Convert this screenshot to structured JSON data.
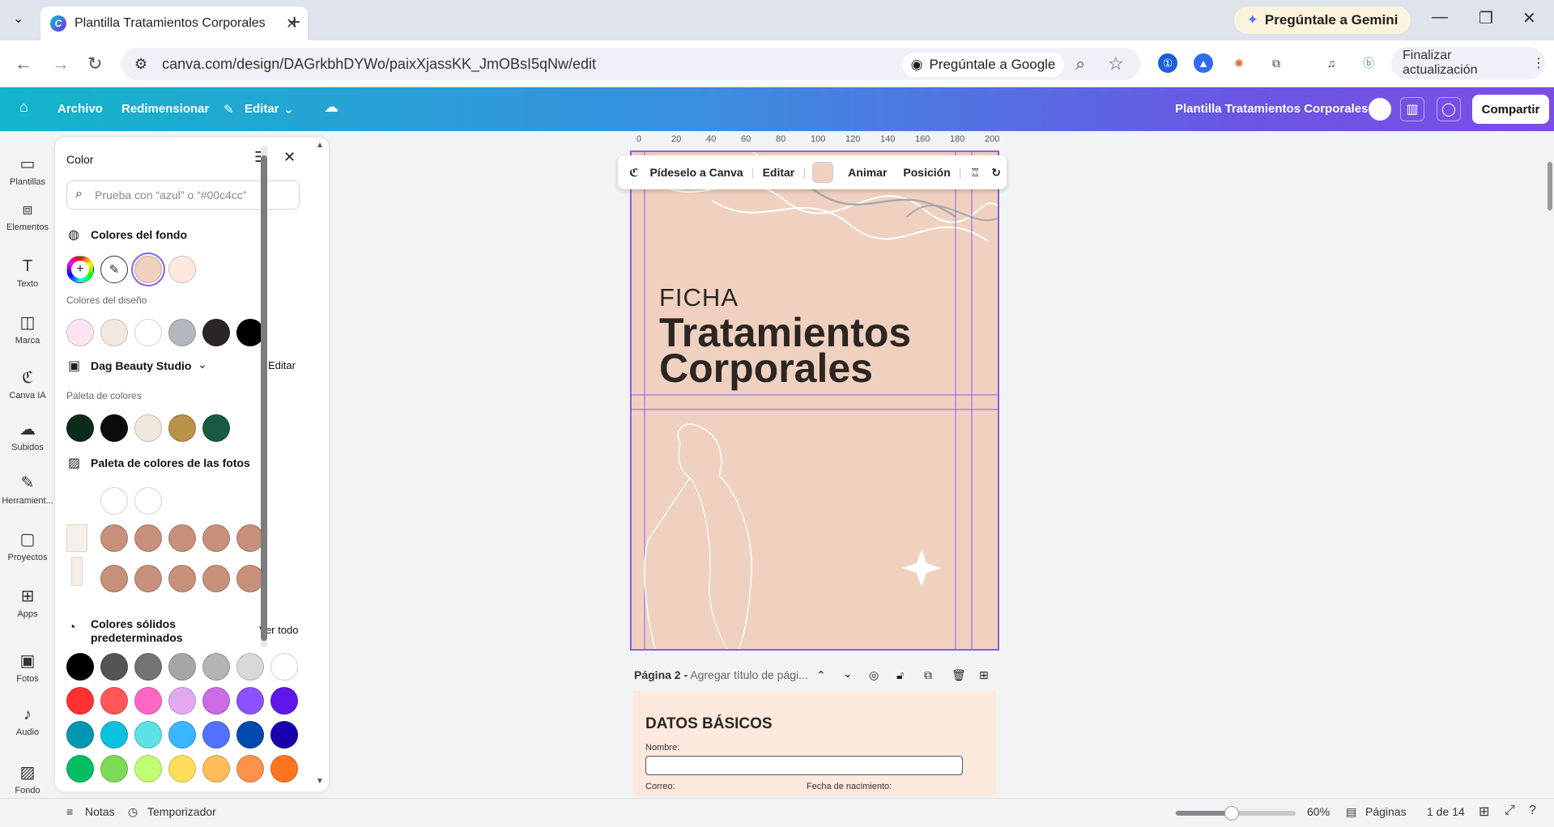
{
  "browser": {
    "tab_title": "Plantilla Tratamientos Corporales",
    "new_tab_symbol": "+",
    "gemini_label": "Pregúntale a Gemini",
    "url": "canva.com/design/DAGrkbhDYWo/paixXjassKK_JmOBsI5qNw/edit",
    "ask_google_label": "Pregúntale a Google",
    "update_label": "Finalizar actualización"
  },
  "header": {
    "archivo": "Archivo",
    "redimensionar": "Redimensionar",
    "editar": "Editar",
    "design_title": "Plantilla Tratamientos Corporales",
    "share_label": "Compartir"
  },
  "rail": {
    "items": [
      "Plantillas",
      "Elementos",
      "Texto",
      "Marca",
      "Canva IA",
      "Subidos",
      "Herramient...",
      "Proyectos",
      "Apps",
      "Fotos",
      "Audio",
      "Fondo"
    ]
  },
  "color_panel": {
    "title": "Color",
    "search_placeholder": "Prueba con “azul” o “#00c4cc”",
    "background_colors_title": "Colores del fondo",
    "background_swatches": [
      "#f0d1bf",
      "#fde9dd"
    ],
    "design_colors_title": "Colores del diseño",
    "design_swatches": [
      "#fce4f1",
      "#f3e8df",
      "#ffffff",
      "#b3b8bf",
      "#2b2623",
      "#000000"
    ],
    "brand_name": "Dag Beauty Studio",
    "brand_edit": "Editar",
    "palette_title": "Paleta de colores",
    "palette_swatches": [
      "#0d2b1c",
      "#0a0a0a",
      "#f1e6dc",
      "#b99149",
      "#1a5a45"
    ],
    "photo_palette_title": "Paleta de colores de las fotos",
    "photo_row1": [
      "#ffffff",
      "#ffffff"
    ],
    "photo_row2": [
      "#c7907a",
      "#c7907a",
      "#c7907a",
      "#c7907a",
      "#c7907a"
    ],
    "photo_row3": [
      "#c7907a",
      "#c7907a",
      "#c7907a",
      "#c7907a",
      "#c7907a"
    ],
    "solid_title": "Colores sólidos predeterminados",
    "see_all": "Ver todo",
    "solid_rows": [
      [
        "#000000",
        "#545454",
        "#737373",
        "#a6a6a6",
        "#b4b4b4",
        "#d9d9d9",
        "#ffffff"
      ],
      [
        "#ff3131",
        "#ff5757",
        "#ff66c4",
        "#e2a9f1",
        "#cb6ce6",
        "#8c52ff",
        "#5e17eb"
      ],
      [
        "#0097b2",
        "#0cc0df",
        "#5ce1e6",
        "#38b6ff",
        "#5271ff",
        "#004aad",
        "#1800ad"
      ],
      [
        "#00bf63",
        "#7ed957",
        "#c1ff72",
        "#ffde59",
        "#ffbd59",
        "#ff914d",
        "#ff751f"
      ]
    ]
  },
  "canvas": {
    "ruler_ticks": [
      "0",
      "20",
      "40",
      "60",
      "80",
      "100",
      "120",
      "140",
      "160",
      "180",
      "200"
    ],
    "toolbar": {
      "ask": "Pídeselo a Canva",
      "edit": "Editar",
      "animate": "Animar",
      "position": "Posición",
      "color": "#f0d1bf"
    },
    "page1": {
      "kicker": "FICHA",
      "title_line1": "Tratamientos",
      "title_line2": "Corporales"
    },
    "page2": {
      "label": "Página 2 -",
      "title_placeholder": "Agregar título de pági...",
      "heading": "DATOS BÁSICOS",
      "name_label": "Nombre:",
      "email_label": "Correo:",
      "dob_label": "Fecha de nacimiento:"
    }
  },
  "bottom": {
    "notes": "Notas",
    "timer": "Temporizador",
    "zoom": "60%",
    "pages_label": "Páginas",
    "page_count": "1 de 14"
  }
}
